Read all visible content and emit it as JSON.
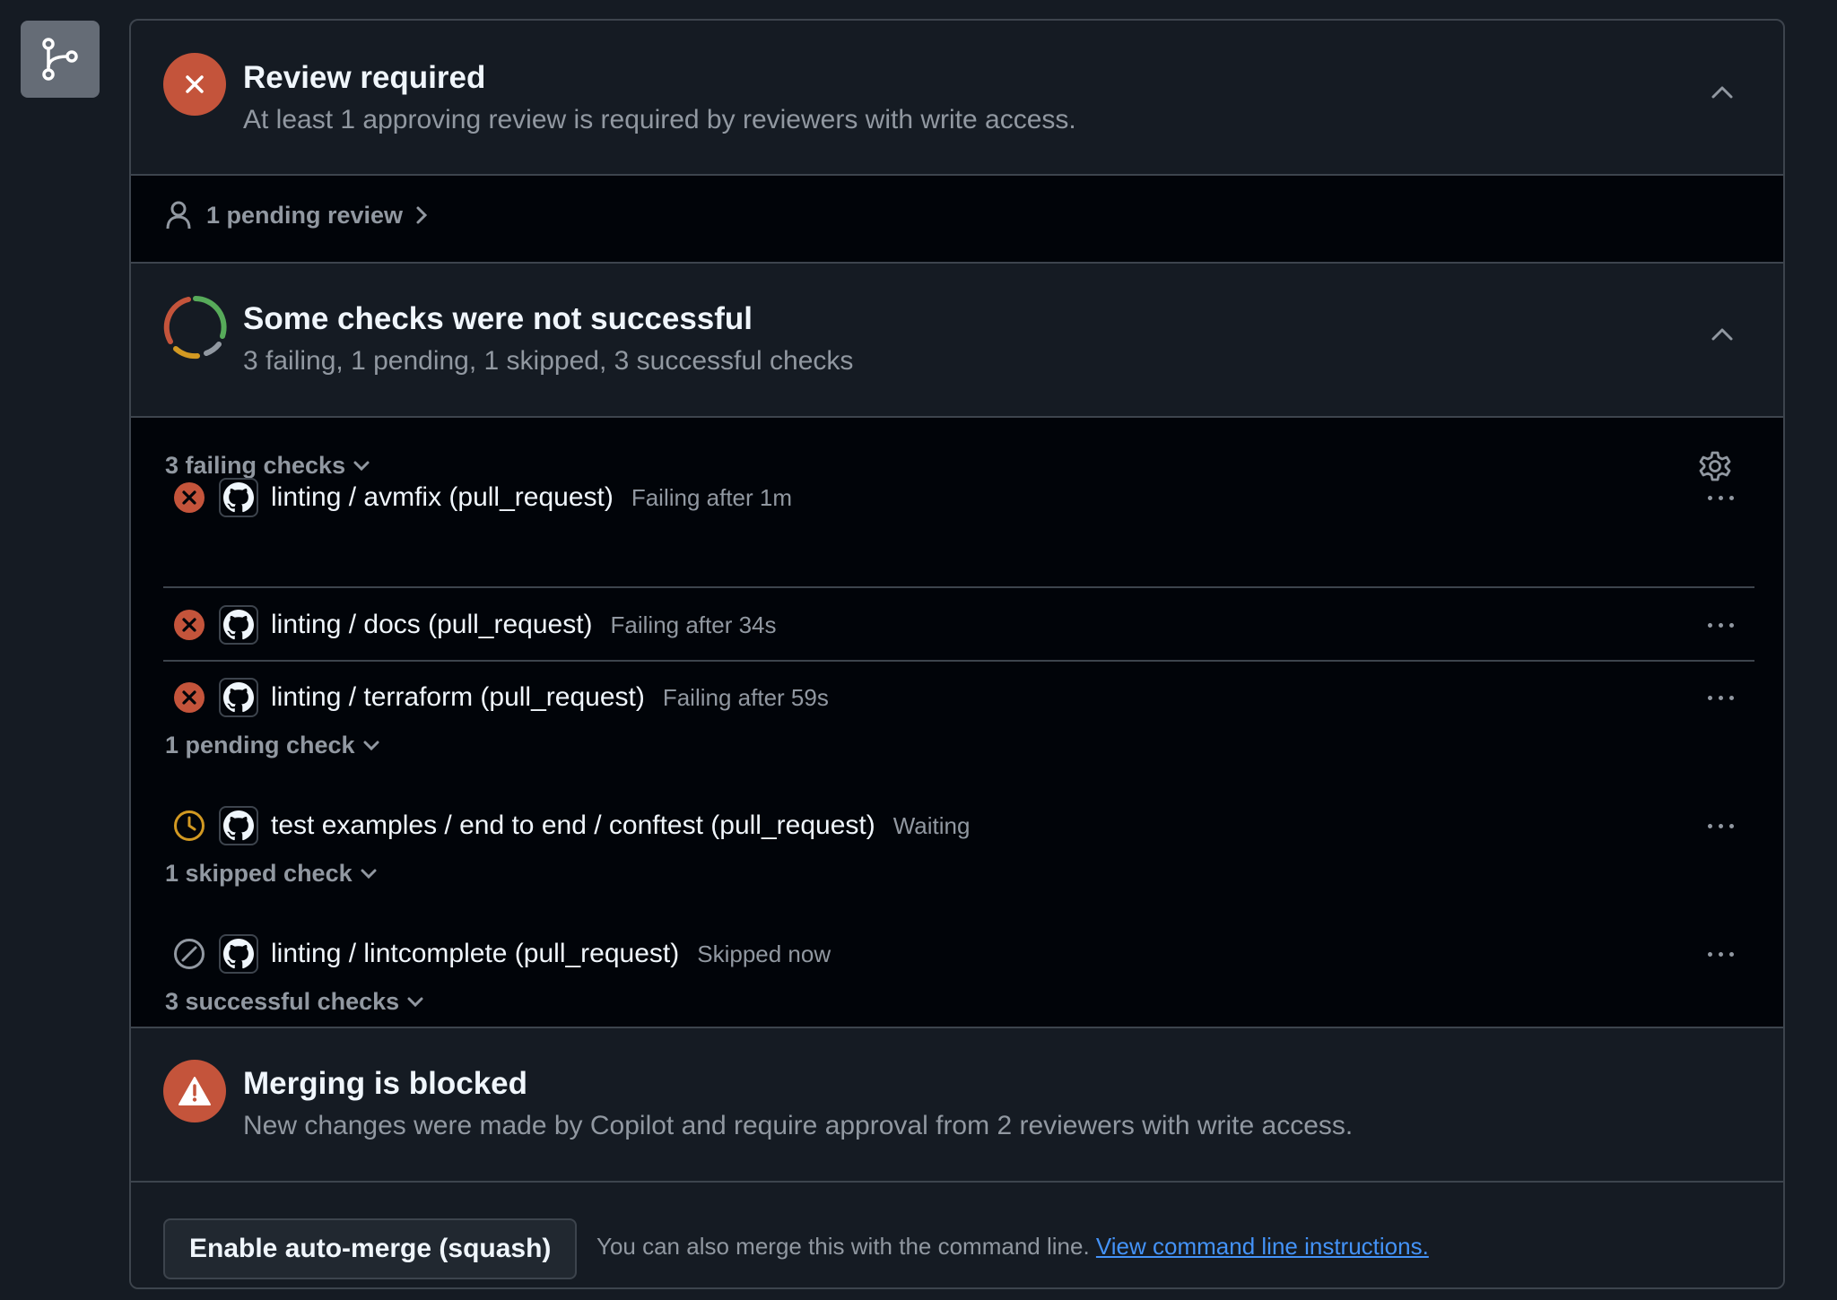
{
  "colors": {
    "danger": "#c4543b",
    "attention": "#d29922",
    "success": "#57ab5a",
    "muted": "#9198a1",
    "link": "#4493f8"
  },
  "sidebar": {
    "icon": "git-branch-icon"
  },
  "review": {
    "icon": "x-icon",
    "title": "Review required",
    "subtitle": "At least 1 approving review is required by reviewers with write access.",
    "pending_label": "1 pending review"
  },
  "checks": {
    "title": "Some checks were not successful",
    "subtitle": "3 failing, 1 pending, 1 skipped, 3 successful checks",
    "failing_label": "3 failing checks",
    "failing": [
      {
        "name": "linting / avmfix (pull_request)",
        "time": "Failing after 1m"
      },
      {
        "name": "linting / docs (pull_request)",
        "time": "Failing after 34s"
      },
      {
        "name": "linting / terraform (pull_request)",
        "time": "Failing after 59s"
      }
    ],
    "pending_label": "1 pending check",
    "pending": [
      {
        "name": "test examples / end to end / conftest (pull_request)",
        "time": "Waiting"
      }
    ],
    "skipped_label": "1 skipped check",
    "skipped": [
      {
        "name": "linting / lintcomplete (pull_request)",
        "time": "Skipped now"
      }
    ],
    "successful_label": "3 successful checks"
  },
  "merge": {
    "title": "Merging is blocked",
    "subtitle": "New changes were made by Copilot and require approval from 2 reviewers with write access.",
    "button_label": "Enable auto-merge (squash)",
    "note": "You can also merge this with the command line.",
    "link_label": "View command line instructions."
  }
}
